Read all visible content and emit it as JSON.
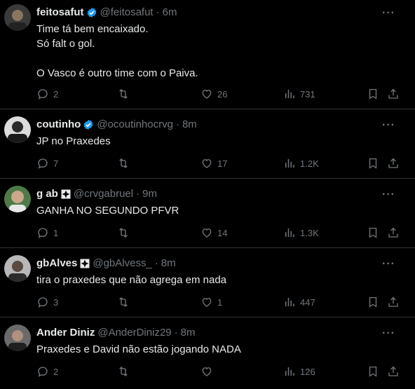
{
  "tweets": [
    {
      "name": "feitosafut",
      "verified": true,
      "cross": false,
      "handle": "@feitosafut",
      "time": "6m",
      "text": "Time tá bem encaixado.\nSó falt o gol.\n\nO Vasco é outro time com o Paiva.",
      "replies": "2",
      "retweets": "",
      "likes": "26",
      "views": "731",
      "avatar_colors": [
        "#3a3a3a",
        "#8a7560"
      ]
    },
    {
      "name": "coutinho",
      "verified": true,
      "cross": false,
      "handle": "@ocoutinhocrvg",
      "time": "8m",
      "text": "JP no Praxedes",
      "replies": "7",
      "retweets": "",
      "likes": "17",
      "views": "1.2K",
      "avatar_colors": [
        "#dcdcdc",
        "#2a2a2a"
      ]
    },
    {
      "name": "g ab",
      "verified": false,
      "cross": true,
      "handle": "@crvgabruel",
      "time": "9m",
      "text": "GANHA NO SEGUNDO PFVR",
      "replies": "1",
      "retweets": "",
      "likes": "14",
      "views": "1.3K",
      "avatar_colors": [
        "#4f7a48",
        "#c9a98a"
      ]
    },
    {
      "name": "gbAlves",
      "verified": false,
      "cross": true,
      "handle": "@gbAlvess_",
      "time": "8m",
      "text": "tira o praxedes que não agrega em nada",
      "replies": "3",
      "retweets": "",
      "likes": "1",
      "views": "447",
      "avatar_colors": [
        "#b8b8b8",
        "#5a4a40"
      ]
    },
    {
      "name": "Ander Diniz",
      "verified": false,
      "cross": false,
      "handle": "@AnderDiniz29",
      "time": "8m",
      "text": "Praxedes e David não estão jogando NADA",
      "replies": "2",
      "retweets": "",
      "likes": "",
      "views": "126",
      "avatar_colors": [
        "#6a6a6a",
        "#b09080"
      ]
    }
  ],
  "colors": {
    "accent": "#1d9bf0",
    "muted": "#71767b",
    "border": "#2f3336",
    "text": "#e7e9ea"
  }
}
